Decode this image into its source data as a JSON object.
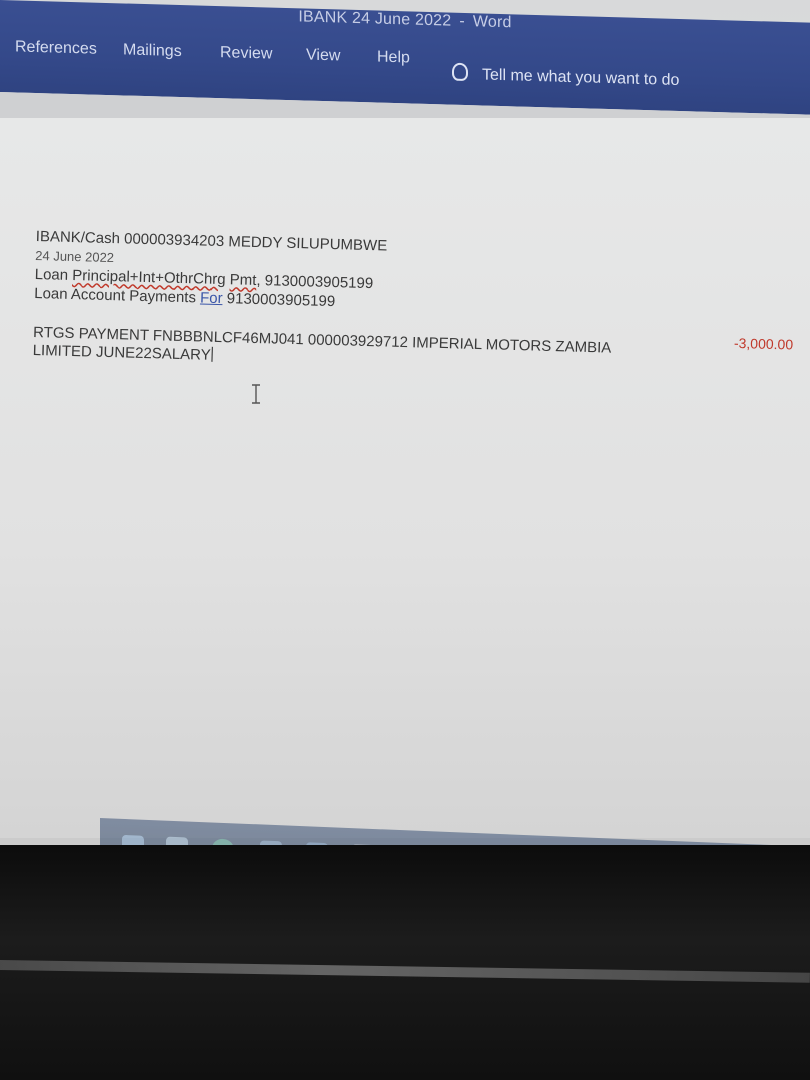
{
  "window": {
    "title_doc": "IBANK 24 June 2022",
    "title_sep": "-",
    "title_app": "Word"
  },
  "ribbon": {
    "tabs": [
      {
        "label": "References"
      },
      {
        "label": "Mailings"
      },
      {
        "label": "Review"
      },
      {
        "label": "View"
      },
      {
        "label": "Help"
      }
    ],
    "tell_me": "Tell me what you want to do"
  },
  "document": {
    "line1": "IBANK/Cash 000003934203 MEDDY SILUPUMBWE",
    "date": "24 June 2022",
    "line3_prefix": "Loan ",
    "line3_sq1": "Principal+Int+OthrChrg",
    "line3_mid": " ",
    "line3_sq2": "Pmt",
    "line3_suffix": ", 9130003905199",
    "line4_prefix": "Loan Account Payments ",
    "line4_link": "For",
    "line4_suffix": "  9130003905199",
    "rtgs_line1": "RTGS PAYMENT FNBBBNLCF46MJ041 000003929712 IMPERIAL MOTORS ZAMBIA",
    "rtgs_line2": "LIMITED JUNE22SALARY",
    "amount": "-3,000.00"
  },
  "colors": {
    "ribbon": "#34498a",
    "amount": "#c0392b",
    "spell_underline": "#c0392b"
  },
  "icons": [
    "lightbulb-icon",
    "text-ibeam-cursor-icon"
  ]
}
